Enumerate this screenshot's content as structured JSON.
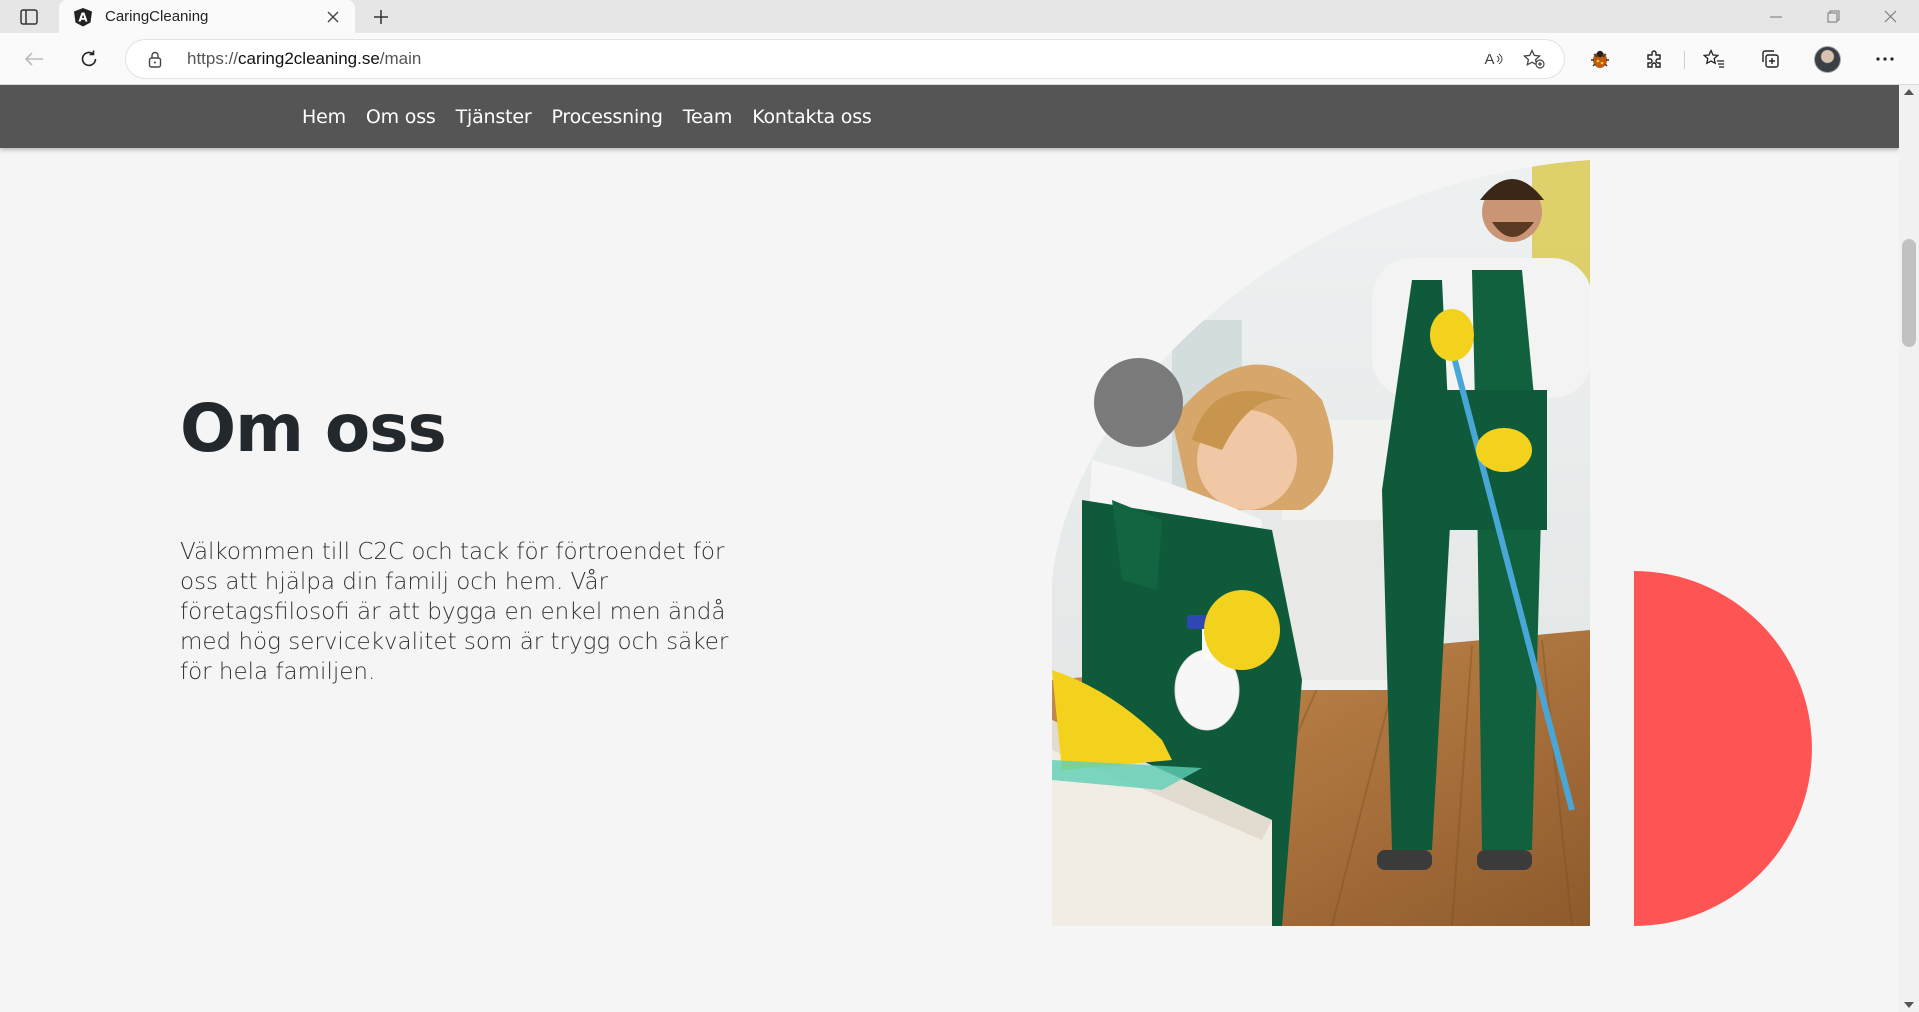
{
  "browser": {
    "tab_title": "CaringCleaning",
    "url_scheme": "https://",
    "url_host": "caring2cleaning.se",
    "url_path": "/main",
    "read_aloud_label": "A",
    "icons": [
      "tab-actions-icon",
      "angular-favicon-icon",
      "close-icon",
      "plus-icon",
      "minimize-icon",
      "restore-icon",
      "close-window-icon",
      "back-icon",
      "refresh-icon",
      "lock-icon",
      "read-aloud-icon",
      "add-favorite-icon",
      "extension-bug-icon",
      "extensions-icon",
      "favorites-icon",
      "collections-icon",
      "more-icon"
    ]
  },
  "nav": {
    "items": [
      "Hem",
      "Om oss",
      "Tjänster",
      "Processning",
      "Team",
      "Kontakta oss"
    ]
  },
  "hero": {
    "title": "Om oss",
    "text": "Välkommen till C2C och tack för förtroendet för oss att hjälpa din familj och hem. Vår företagsfilosofi är att bygga en enkel men ändå med hög servicekvalitet som är trygg och säker för hela familjen."
  },
  "colors": {
    "navbar": "#555555",
    "accent_red": "#fe5454",
    "dot_gray": "#7a7a7a",
    "page_bg": "#f5f5f5",
    "overall_green": "#0f5a3a",
    "glove_yellow": "#f2d21d"
  }
}
